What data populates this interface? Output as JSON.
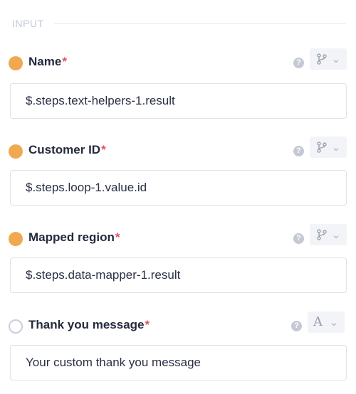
{
  "section": {
    "title": "INPUT"
  },
  "fields": [
    {
      "label": "Name",
      "required": "*",
      "value": "$.steps.text-helpers-1.result",
      "help": "?",
      "status": "set",
      "type_icon": "branch-icon"
    },
    {
      "label": "Customer ID",
      "required": "*",
      "value": "$.steps.loop-1.value.id",
      "help": "?",
      "status": "set",
      "type_icon": "branch-icon"
    },
    {
      "label": "Mapped region",
      "required": "*",
      "value": "$.steps.data-mapper-1.result",
      "help": "?",
      "status": "set",
      "type_icon": "branch-icon"
    },
    {
      "label": "Thank you message",
      "required": "*",
      "value": "Your custom thank you message",
      "help": "?",
      "status": "unset",
      "type_icon": "text-icon",
      "type_letter": "A"
    }
  ],
  "colors": {
    "status_set": "#f0a851",
    "required": "#e84c5b",
    "muted": "#c3c8d6"
  }
}
